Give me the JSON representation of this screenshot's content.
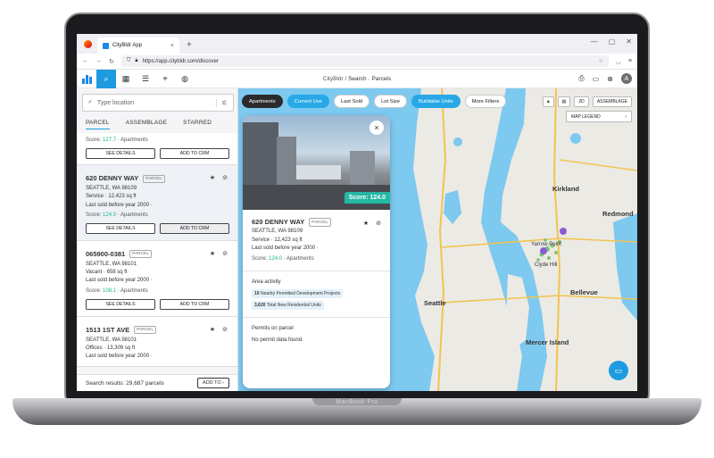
{
  "device": {
    "brand": "MacBook Pro"
  },
  "browser": {
    "tab_title": "CityBldr App",
    "tab_close": "×",
    "new_tab": "+",
    "url": "https://app.citybldr.com/discover",
    "window_controls": [
      "—",
      "▢",
      "✕"
    ]
  },
  "toolbar": {
    "breadcrumb_root": "CityBldr",
    "breadcrumb_sep": "/",
    "breadcrumb_page": "Search · Parcels",
    "avatar_initial": "A"
  },
  "search": {
    "placeholder": "Type location"
  },
  "left_tabs": [
    "PARCEL",
    "ASSEMBLAGE",
    "STARRED"
  ],
  "cards": [
    {
      "address": "",
      "badge": "",
      "city": "",
      "use": "",
      "last_sold": "",
      "score_label": "Score:",
      "score": "127.7",
      "score_type": "· Apartments",
      "details_label": "SEE DETAILS",
      "crm_label": "ADD TO CRM"
    },
    {
      "address": "620 DENNY WAY",
      "badge": "PARCEL",
      "city": "SEATTLE, WA 98109",
      "use": "Service · 12,423 sq ft",
      "last_sold": "Last sold before year 2000 ·",
      "score_label": "Score:",
      "score": "124.0",
      "score_type": "· Apartments",
      "details_label": "SEE DETAILS",
      "crm_label": "ADD TO CRM"
    },
    {
      "address": "065900-0381",
      "badge": "PARCEL",
      "city": "SEATTLE, WA 98101",
      "use": "Vacant · 658 sq ft",
      "last_sold": "Last sold before year 2000 ·",
      "score_label": "Score:",
      "score": "108.1",
      "score_type": "· Apartments",
      "details_label": "SEE DETAILS",
      "crm_label": "ADD TO CRM"
    },
    {
      "address": "1513 1ST AVE",
      "badge": "PARCEL",
      "city": "SEATTLE, WA 98101",
      "use": "Offices · 13,309 sq ft",
      "last_sold": "Last sold before year 2000 ·"
    }
  ],
  "results": {
    "label": "Search results: 29,687 parcels",
    "add_label": "ADD TO"
  },
  "filters": [
    "Apartments",
    "Current Use",
    "Last Sold",
    "Lot Size",
    "Buildable Units",
    "More Filters"
  ],
  "map_tools": {
    "mode_2d": "2D",
    "assemblage": "ASSEMBLAGE",
    "legend": "MAP LEGEND"
  },
  "map_labels": {
    "seattle": "Seattle",
    "kirkland": "Kirkland",
    "redmond": "Redmond",
    "yarrow_point": "Yarrow Point",
    "clyde_hill": "Clyde Hill",
    "bellevue": "Bellevue",
    "mercer_island": "Mercer Island"
  },
  "popup": {
    "close": "×",
    "score_tag": "Score: 124.0",
    "address": "620 DENNY WAY",
    "badge": "PARCEL",
    "city": "SEATTLE, WA 98109",
    "use": "Service · 12,423 sq ft",
    "last_sold": "Last sold before year 2000 ·",
    "score_label": "Score:",
    "score": "124.0",
    "score_type": "· Apartments",
    "area_title": "Area activity",
    "permitted_count": "10",
    "permitted_label": "Nearby Permitted Development Projects",
    "residential_count": "3,620",
    "residential_label": "Total New Residential Units",
    "permits_title": "Permits on parcel",
    "permits_empty": "No permit data found."
  },
  "colors": {
    "accent": "#1e9be0",
    "score": "#19b394",
    "water": "#7dc9ef",
    "land": "#eceae4"
  }
}
